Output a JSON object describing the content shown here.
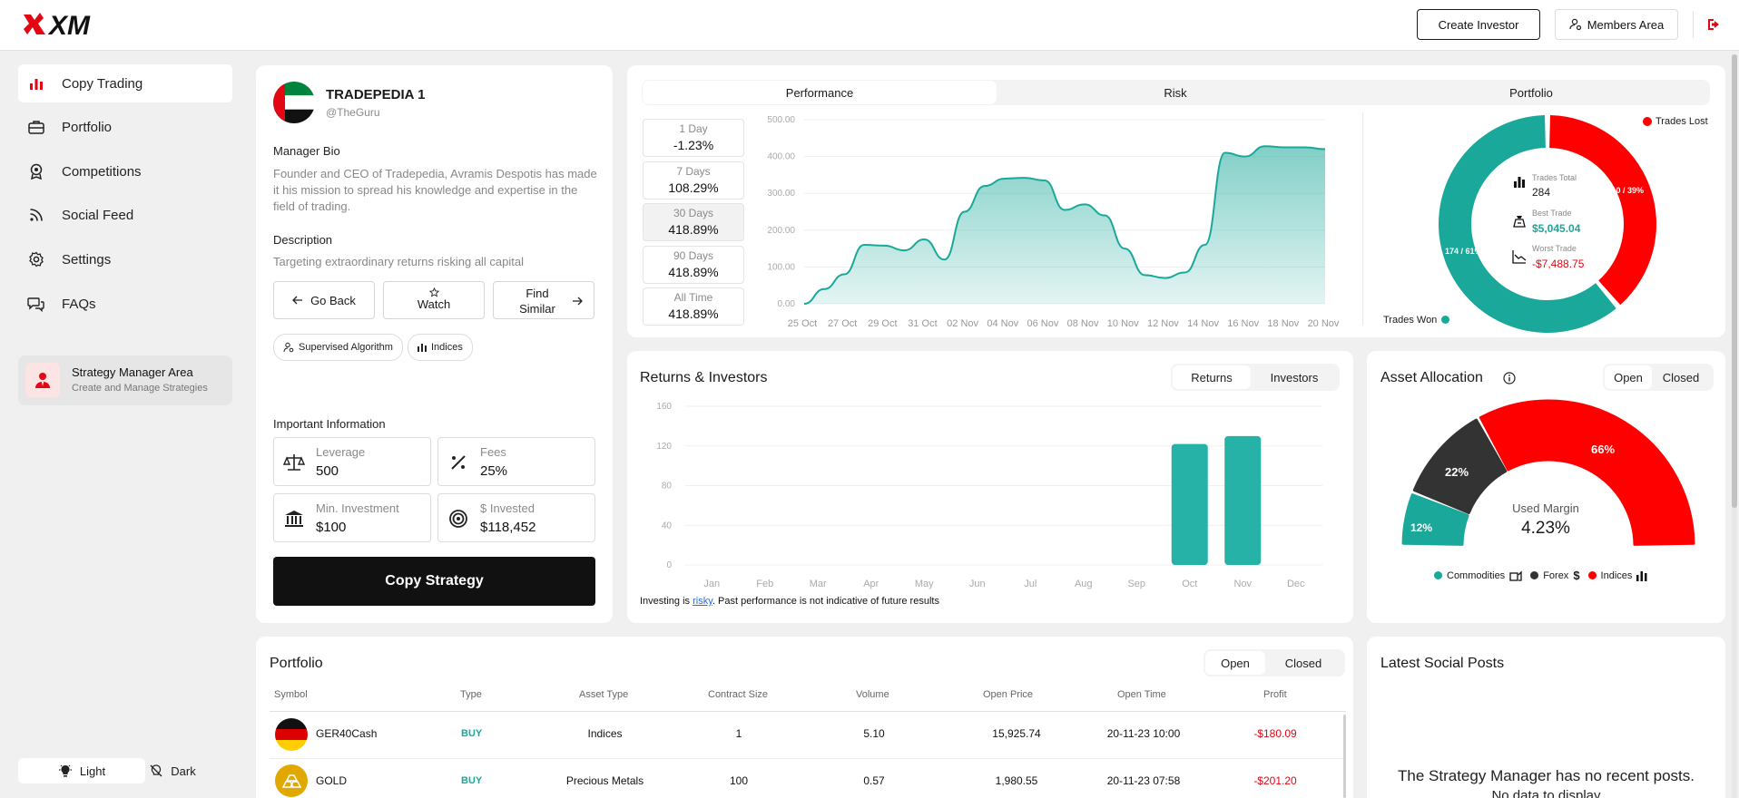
{
  "header": {
    "create_investor": "Create Investor",
    "members_area": "Members Area"
  },
  "sidebar": {
    "items": [
      {
        "label": "Copy Trading",
        "icon": "bar-chart-icon"
      },
      {
        "label": "Portfolio",
        "icon": "briefcase-icon"
      },
      {
        "label": "Competitions",
        "icon": "award-icon"
      },
      {
        "label": "Social Feed",
        "icon": "rss-icon"
      },
      {
        "label": "Settings",
        "icon": "gear-icon"
      },
      {
        "label": "FAQs",
        "icon": "chat-icon"
      }
    ],
    "strategy_manager": {
      "title": "Strategy Manager Area",
      "subtitle": "Create and Manage Strategies"
    },
    "theme": {
      "light": "Light",
      "dark": "Dark"
    }
  },
  "profile": {
    "name": "TRADEPEDIA 1",
    "handle": "@TheGuru",
    "bio_heading": "Manager Bio",
    "bio": "Founder and CEO of Tradepedia, Avramis Despotis has made it his mission to spread his knowledge and expertise in the field of trading.",
    "description_heading": "Description",
    "description": "Targeting extraordinary returns risking all capital",
    "go_back": "Go Back",
    "watch": "Watch",
    "find_similar_1": "Find",
    "find_similar_2": "Similar",
    "tags": [
      "Supervised Algorithm",
      "Indices"
    ],
    "important_heading": "Important Information",
    "leverage_label": "Leverage",
    "leverage": "500",
    "fees_label": "Fees",
    "fees": "25%",
    "min_inv_label": "Min. Investment",
    "min_inv": "$100",
    "invested_label": "$ Invested",
    "invested": "$118,452",
    "copy_button": "Copy Strategy"
  },
  "performance": {
    "tabs": [
      "Performance",
      "Risk",
      "Portfolio"
    ],
    "periods": [
      {
        "label": "1 Day",
        "value": "-1.23%"
      },
      {
        "label": "7 Days",
        "value": "108.29%"
      },
      {
        "label": "30 Days",
        "value": "418.89%"
      },
      {
        "label": "90 Days",
        "value": "418.89%"
      },
      {
        "label": "All Time",
        "value": "418.89%"
      }
    ],
    "chart_data": {
      "type": "area",
      "x": [
        "25 Oct",
        "27 Oct",
        "29 Oct",
        "31 Oct",
        "02 Nov",
        "04 Nov",
        "06 Nov",
        "08 Nov",
        "10 Nov",
        "12 Nov",
        "14 Nov",
        "16 Nov",
        "18 Nov",
        "20 Nov"
      ],
      "y_ticks": [
        "500.00",
        "400.00",
        "300.00",
        "200.00",
        "100.00",
        "0.00"
      ],
      "ylim": [
        0,
        500
      ],
      "points": [
        [
          0,
          0
        ],
        [
          0.5,
          40
        ],
        [
          1,
          80
        ],
        [
          1.5,
          160
        ],
        [
          2,
          158
        ],
        [
          2.5,
          145
        ],
        [
          3,
          175
        ],
        [
          3.5,
          120
        ],
        [
          4,
          250
        ],
        [
          4.5,
          320
        ],
        [
          5,
          340
        ],
        [
          5.5,
          342
        ],
        [
          6,
          335
        ],
        [
          6.5,
          255
        ],
        [
          7,
          270
        ],
        [
          7.5,
          240
        ],
        [
          8,
          150
        ],
        [
          8.5,
          78
        ],
        [
          9,
          70
        ],
        [
          9.5,
          85
        ],
        [
          10,
          160
        ],
        [
          10.5,
          410
        ],
        [
          11,
          400
        ],
        [
          11.5,
          428
        ],
        [
          12,
          425
        ],
        [
          12.5,
          425
        ],
        [
          13,
          420
        ]
      ],
      "fill": "#1aa89a"
    }
  },
  "donut": {
    "legend_lost": "Trades Lost",
    "legend_won": "Trades Won",
    "won_label": "174 / 61%",
    "lost_label": "110 / 39%",
    "total_label": "Trades Total",
    "total": "284",
    "best_label": "Best Trade",
    "best": "$5,045.04",
    "worst_label": "Worst Trade",
    "worst": "-$7,488.75",
    "chart_data": {
      "type": "pie",
      "categories": [
        "Trades Won",
        "Trades Lost"
      ],
      "values": [
        174,
        110
      ],
      "colors": [
        "#1aa89a",
        "#ff0000"
      ]
    }
  },
  "returns": {
    "title": "Returns & Investors",
    "tabs": [
      "Returns",
      "Investors"
    ],
    "disclaimer_1": "Investing is ",
    "disclaimer_link": "risky",
    "disclaimer_2": ". Past performance is not indicative of future results",
    "chart_data": {
      "type": "bar",
      "categories": [
        "Jan",
        "Feb",
        "Mar",
        "Apr",
        "May",
        "Jun",
        "Jul",
        "Aug",
        "Sep",
        "Oct",
        "Nov",
        "Dec"
      ],
      "values": [
        0,
        0,
        0,
        0,
        0,
        0,
        0,
        0,
        0,
        122,
        130,
        0
      ],
      "y_ticks": [
        "160",
        "120",
        "80",
        "40",
        "0"
      ],
      "ylim": [
        0,
        160
      ],
      "color": "#26b2a6"
    }
  },
  "allocation": {
    "title": "Asset Allocation",
    "tabs": [
      "Open",
      "Closed"
    ],
    "center_label": "Used Margin",
    "center_value": "4.23%",
    "legend": [
      "Commodities",
      "Forex",
      "Indices"
    ],
    "chart_data": {
      "type": "pie",
      "categories": [
        "Commodities",
        "Forex",
        "Indices"
      ],
      "values": [
        12,
        22,
        66
      ],
      "colors": [
        "#1aa89a",
        "#333333",
        "#ff0000"
      ]
    },
    "labels": [
      "12%",
      "22%",
      "66%"
    ]
  },
  "portfolio": {
    "title": "Portfolio",
    "tabs": [
      "Open",
      "Closed"
    ],
    "columns": [
      "Symbol",
      "Type",
      "Asset Type",
      "Contract Size",
      "Volume",
      "Open Price",
      "Open Time",
      "Profit"
    ],
    "rows": [
      {
        "symbol": "GER40Cash",
        "type": "BUY",
        "asset": "Indices",
        "size": "1",
        "volume": "5.10",
        "price": "15,925.74",
        "time": "20-11-23 10:00",
        "profit": "-$180.09"
      },
      {
        "symbol": "GOLD",
        "type": "BUY",
        "asset": "Precious Metals",
        "size": "100",
        "volume": "0.57",
        "price": "1,980.55",
        "time": "20-11-23 07:58",
        "profit": "-$201.20"
      }
    ]
  },
  "social": {
    "title": "Latest Social Posts",
    "empty_1": "The Strategy Manager has no recent posts.",
    "empty_2": "No data to display"
  }
}
